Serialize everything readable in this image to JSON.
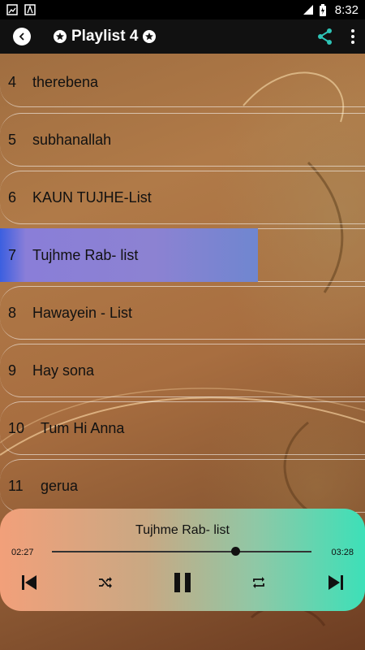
{
  "status_bar": {
    "time": "8:32"
  },
  "app_bar": {
    "title": "Playlist 4"
  },
  "playlist": [
    {
      "num": "4",
      "name": "therebena"
    },
    {
      "num": "5",
      "name": "subhanallah"
    },
    {
      "num": "6",
      "name": "KAUN TUJHE-List"
    },
    {
      "num": "7",
      "name": "Tujhme Rab- list",
      "active": true
    },
    {
      "num": "8",
      "name": "Hawayein - List"
    },
    {
      "num": "9",
      "name": "Hay sona"
    },
    {
      "num": "10",
      "name": "Tum Hi Anna"
    },
    {
      "num": "11",
      "name": "gerua"
    }
  ],
  "player": {
    "now_playing": "Tujhme Rab- list",
    "current_time": "02:27",
    "total_time": "03:28",
    "progress": 0.7067
  },
  "colors": {
    "accent": "#2ec4b6",
    "active_row": "#8c82d2"
  }
}
